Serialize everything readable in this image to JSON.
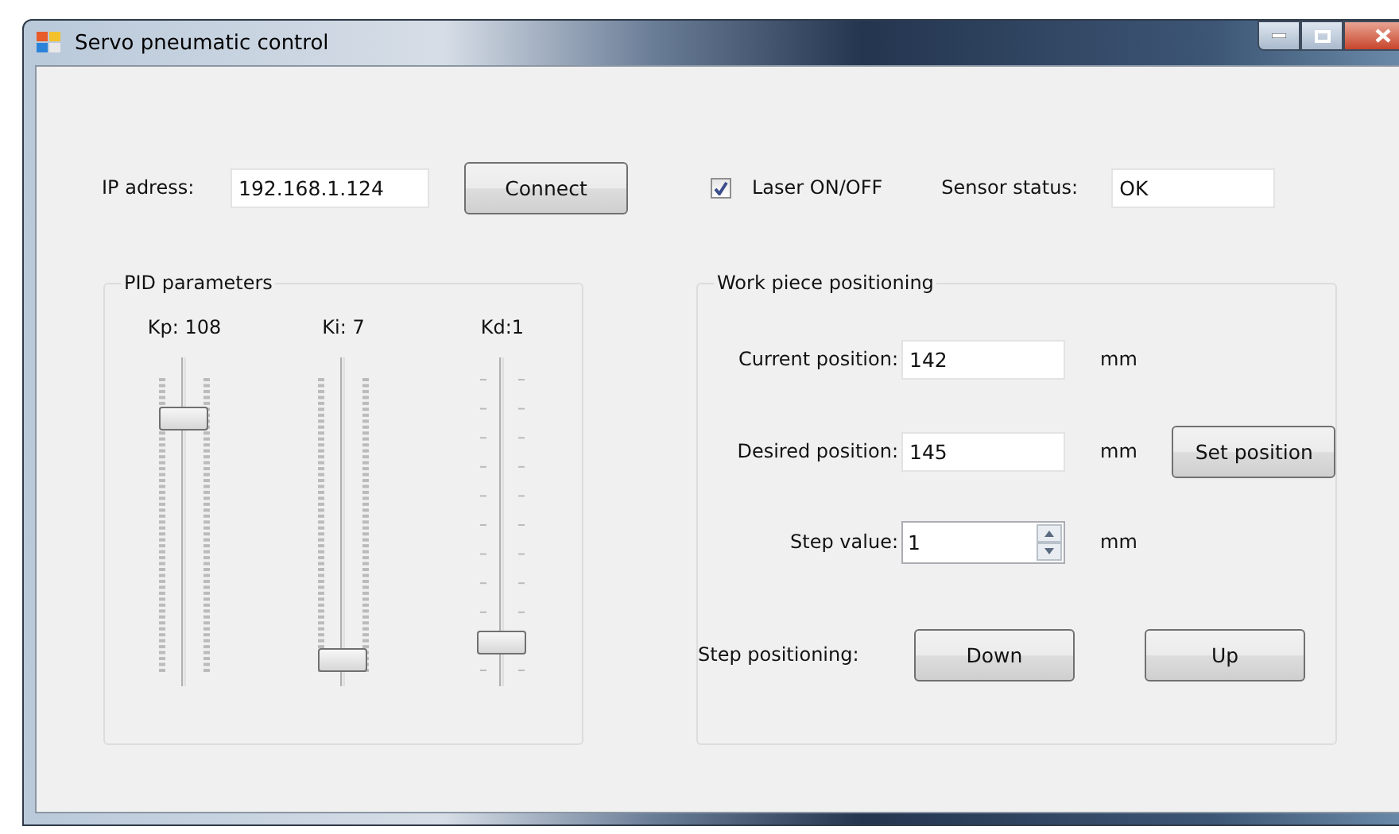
{
  "window": {
    "title": "Servo pneumatic control"
  },
  "connection": {
    "label": "IP adress:",
    "value": "192.168.1.124",
    "button": "Connect"
  },
  "laser": {
    "label": "Laser ON/OFF",
    "checked": true
  },
  "sensor": {
    "label": "Sensor status:",
    "value": "OK"
  },
  "pid": {
    "title": "PID parameters",
    "sliders": [
      {
        "label": "Kp: 108",
        "level": 0.86,
        "kind": "dense"
      },
      {
        "label": "Ki: 7",
        "level": 0.04,
        "kind": "dense"
      },
      {
        "label": "Kd:1",
        "level": 0.1,
        "kind": "sparse"
      }
    ]
  },
  "positioning": {
    "title": "Work piece positioning",
    "current": {
      "label": "Current position:",
      "value": "142",
      "unit": "mm"
    },
    "desired": {
      "label": "Desired position:",
      "value": "145",
      "unit": "mm",
      "button": "Set position"
    },
    "step": {
      "label": "Step value:",
      "value": "1",
      "unit": "mm"
    },
    "step_positioning": {
      "label": "Step positioning:",
      "buttons": [
        "Down",
        "Up"
      ]
    }
  }
}
